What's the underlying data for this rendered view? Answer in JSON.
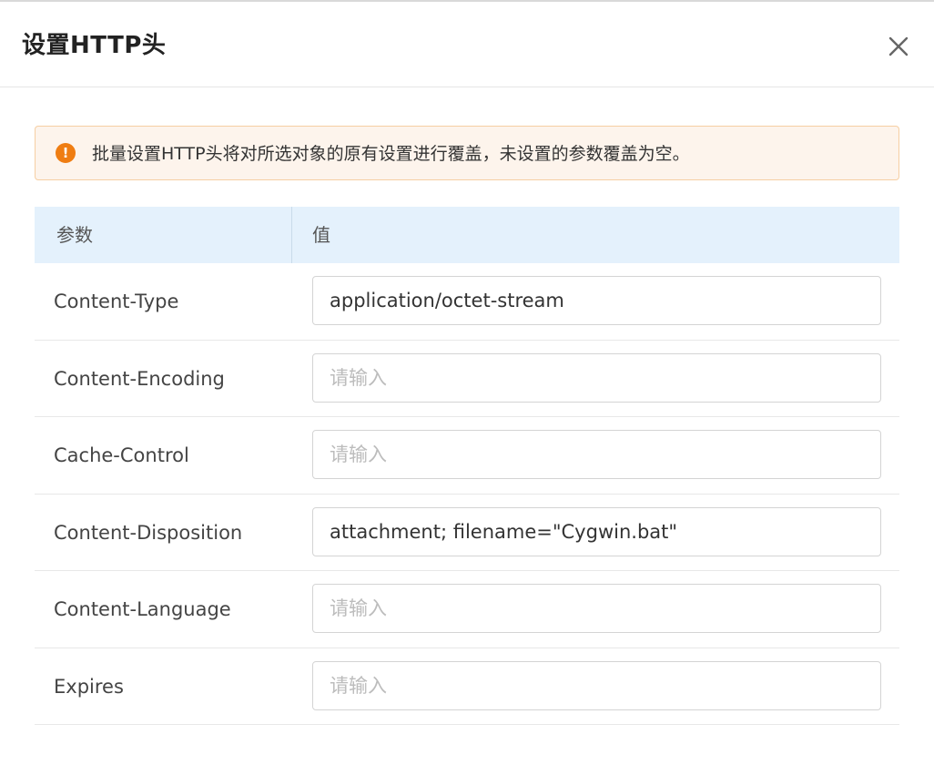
{
  "dialog": {
    "title": "设置HTTP头"
  },
  "alert": {
    "icon": "exclamation-circle-icon",
    "text": "批量设置HTTP头将对所选对象的原有设置进行覆盖，未设置的参数覆盖为空。",
    "color": "#ef7d12"
  },
  "table": {
    "headers": {
      "param": "参数",
      "value": "值"
    },
    "rows": [
      {
        "label": "Content-Type",
        "value": "application/octet-stream",
        "placeholder": "请输入"
      },
      {
        "label": "Content-Encoding",
        "value": "",
        "placeholder": "请输入"
      },
      {
        "label": "Cache-Control",
        "value": "",
        "placeholder": "请输入"
      },
      {
        "label": "Content-Disposition",
        "value": "attachment; filename=\"Cygwin.bat\"",
        "placeholder": "请输入"
      },
      {
        "label": "Content-Language",
        "value": "",
        "placeholder": "请输入"
      },
      {
        "label": "Expires",
        "value": "",
        "placeholder": "请输入"
      }
    ]
  }
}
